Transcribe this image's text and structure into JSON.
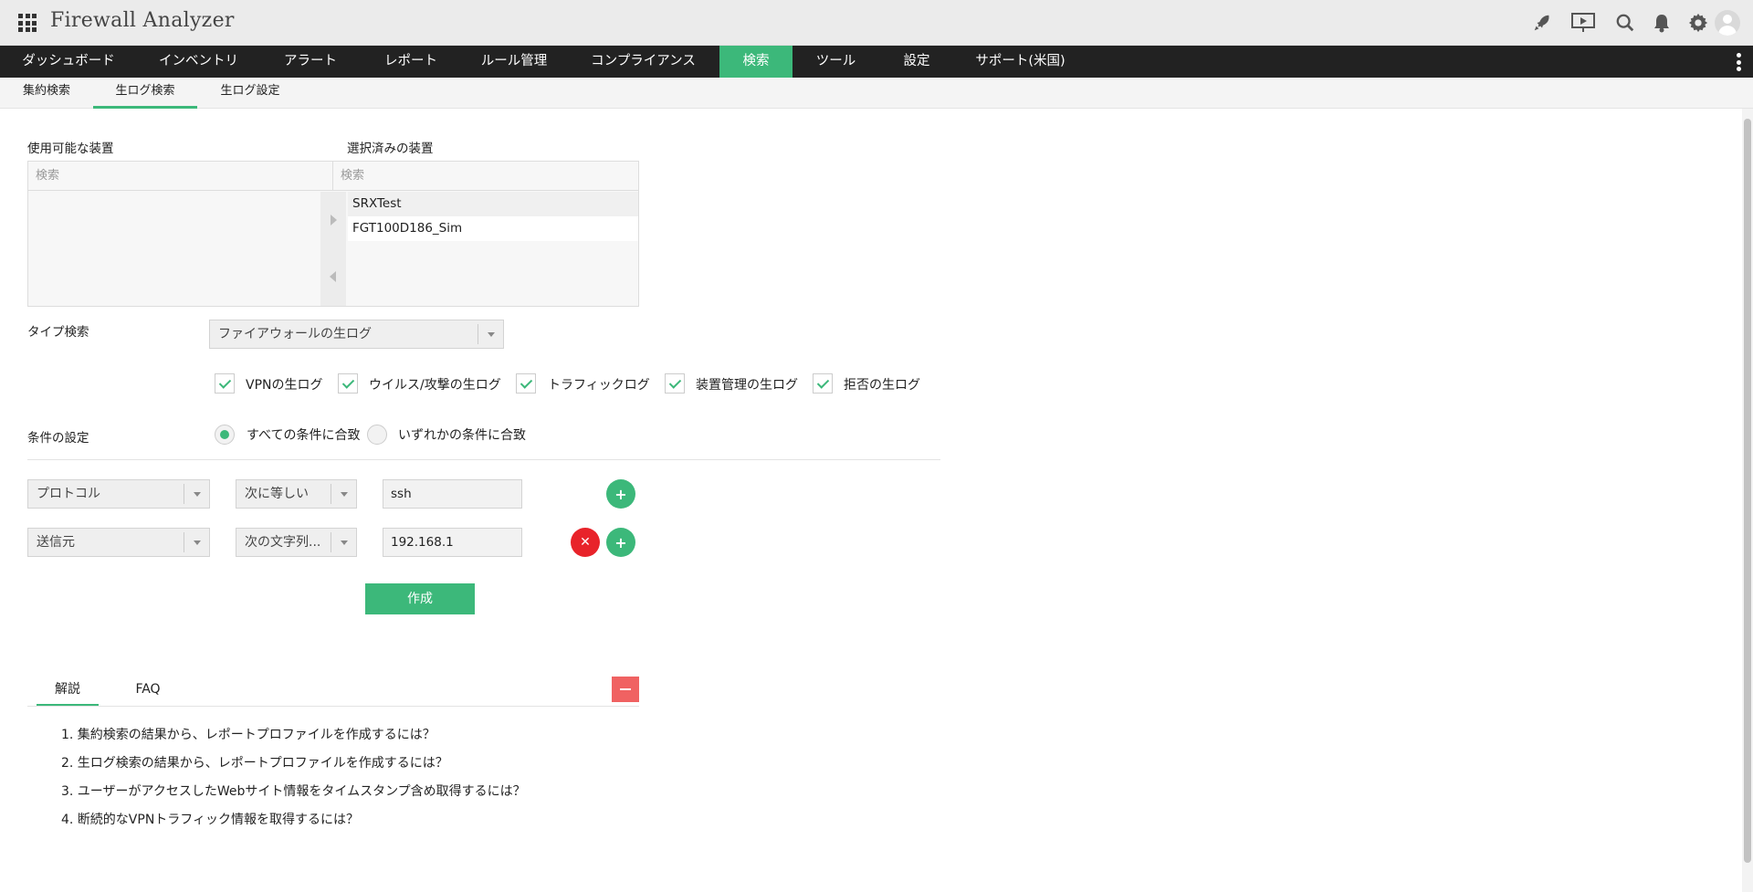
{
  "app": {
    "title": "Firewall Analyzer"
  },
  "topbar": {
    "icons": [
      "rocket-icon",
      "presentation-icon",
      "search-icon",
      "bell-icon",
      "gear-icon",
      "avatar-icon"
    ]
  },
  "nav": {
    "items": [
      "ダッシュボード",
      "インベントリ",
      "アラート",
      "レポート",
      "ルール管理",
      "コンプライアンス",
      "検索",
      "ツール",
      "設定",
      "サポート(米国)"
    ],
    "active": "検索"
  },
  "subnav": {
    "items": [
      "集約検索",
      "生ログ検索",
      "生ログ設定"
    ],
    "active": "生ログ検索"
  },
  "devices": {
    "available_label": "使用可能な装置",
    "selected_label": "選択済みの装置",
    "available_search_placeholder": "検索",
    "selected_search_placeholder": "検索",
    "available_items": [],
    "selected_items": [
      "SRXTest",
      "FGT100D186_Sim"
    ]
  },
  "type_search": {
    "label": "タイプ検索",
    "value": "ファイアウォールの生ログ"
  },
  "log_types": [
    {
      "label": "VPNの生ログ",
      "checked": true
    },
    {
      "label": "ウイルス/攻撃の生ログ",
      "checked": true
    },
    {
      "label": "トラフィックログ",
      "checked": true
    },
    {
      "label": "装置管理の生ログ",
      "checked": true
    },
    {
      "label": "拒否の生ログ",
      "checked": true
    }
  ],
  "conditions": {
    "label": "条件の設定",
    "match_all": "すべての条件に合致",
    "match_any": "いずれかの条件に合致",
    "selected": "match_all",
    "rows": [
      {
        "field": "プロトコル",
        "operator": "次に等しい",
        "value": "ssh"
      },
      {
        "field": "送信元",
        "operator": "次の文字列...",
        "value": "192.168.1"
      }
    ]
  },
  "actions": {
    "create": "作成",
    "add": "+",
    "remove": "✕"
  },
  "help": {
    "tabs": [
      "解説",
      "FAQ"
    ],
    "active": "解説",
    "items": [
      "1. 集約検索の結果から、レポートプロファイルを作成するには？",
      "2. 生ログ検索の結果から、レポートプロファイルを作成するには？",
      "3. ユーザーがアクセスしたWebサイト情報をタイムスタンプ含め取得するには？",
      "4. 断続的なVPNトラフィック情報を取得するには？"
    ]
  },
  "colors": {
    "accent": "#3cb87a",
    "nav_bg": "#222222",
    "danger": "#e8232a",
    "collapse": "#f06262"
  }
}
